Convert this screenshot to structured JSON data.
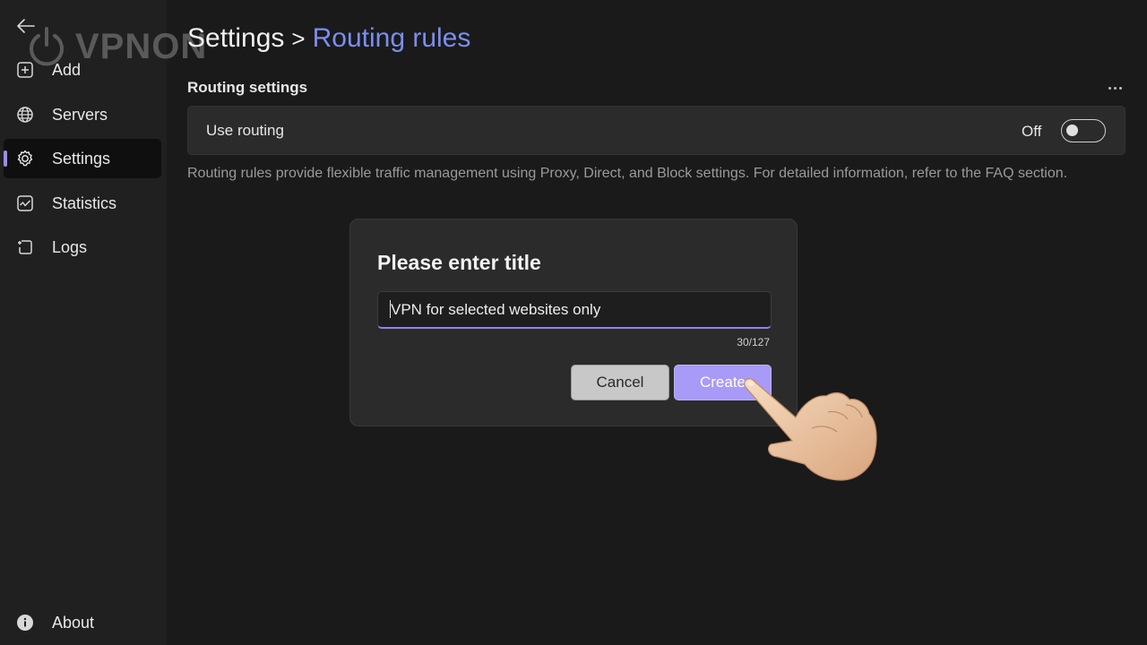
{
  "sidebar": {
    "items": [
      {
        "label": "Add",
        "icon": "add-square-icon"
      },
      {
        "label": "Servers",
        "icon": "globe-icon"
      },
      {
        "label": "Settings",
        "icon": "gear-icon",
        "active": true
      },
      {
        "label": "Statistics",
        "icon": "chart-icon"
      },
      {
        "label": "Logs",
        "icon": "log-icon"
      }
    ],
    "footer_item": {
      "label": "About",
      "icon": "info-icon"
    }
  },
  "logo": {
    "text": "VPNON"
  },
  "breadcrumb": {
    "root": "Settings",
    "separator": ">",
    "current": "Routing rules"
  },
  "section": {
    "title": "Routing settings"
  },
  "routing_card": {
    "label": "Use routing",
    "toggle_state": "Off",
    "toggle_on": false
  },
  "description": "Routing rules provide flexible traffic management using Proxy, Direct, and Block settings. For detailed information, refer to the FAQ section.",
  "dialog": {
    "title": "Please enter title",
    "input_value": "VPN for selected websites only",
    "char_count": "30/127",
    "cancel_label": "Cancel",
    "create_label": "Create"
  },
  "colors": {
    "accent": "#9b8cf5",
    "breadcrumb_current": "#7b8ef0",
    "create_button": "#a89af7",
    "background": "#1a1a1a"
  }
}
